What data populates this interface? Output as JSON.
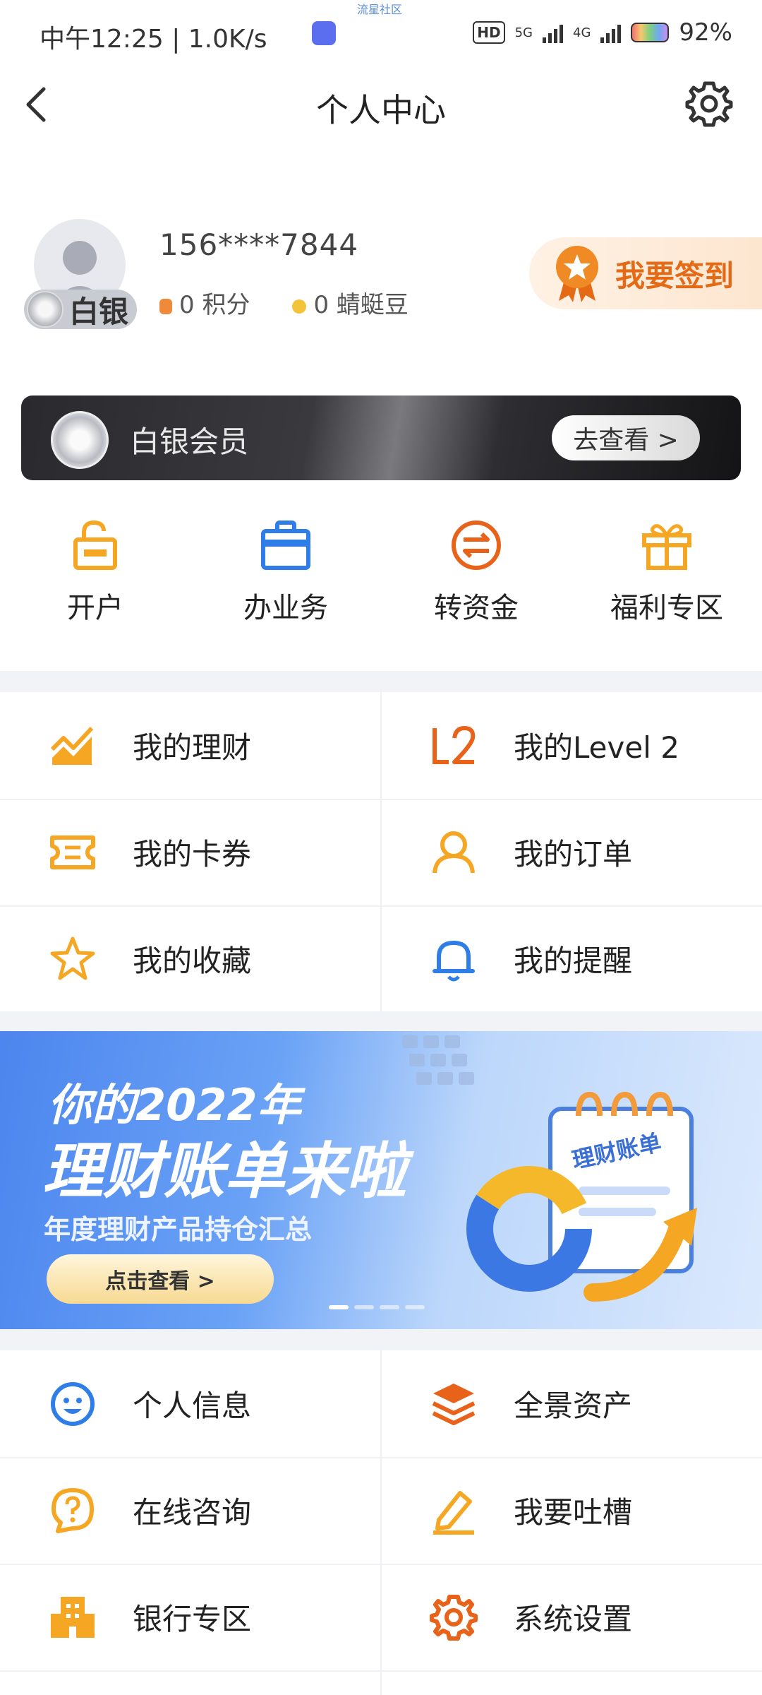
{
  "status_bar": {
    "time": "中午12:25 | 1.0K/s",
    "carrier_notice": "流星社区",
    "hd": "HD",
    "net1": "5G",
    "net2": "4G",
    "battery": "92%"
  },
  "header": {
    "title": "个人中心"
  },
  "profile": {
    "level_badge": "白银",
    "phone": "156****7844",
    "points": "0 积分",
    "beans": "0 蜻蜓豆",
    "signin_label": "我要签到"
  },
  "member": {
    "label": "白银会员",
    "button": "去查看 >"
  },
  "quick_actions": [
    {
      "label": "开户",
      "icon": "lock-open-icon"
    },
    {
      "label": "办业务",
      "icon": "briefcase-icon"
    },
    {
      "label": "转资金",
      "icon": "transfer-icon"
    },
    {
      "label": "福利专区",
      "icon": "gift-icon"
    }
  ],
  "menu1": [
    {
      "label": "我的理财",
      "icon": "chart-icon"
    },
    {
      "label": "我的Level 2",
      "icon": "level2-icon"
    },
    {
      "label": "我的卡券",
      "icon": "ticket-icon"
    },
    {
      "label": "我的订单",
      "icon": "user-icon"
    },
    {
      "label": "我的收藏",
      "icon": "star-icon"
    },
    {
      "label": "我的提醒",
      "icon": "bell-icon"
    }
  ],
  "banner": {
    "line1": "你的2022年",
    "line2": "理财账单来啦",
    "line3": "年度理财产品持仓汇总",
    "cta": "点击查看 >",
    "card_title": "理财账单"
  },
  "menu2": [
    {
      "label": "个人信息",
      "icon": "smile-icon"
    },
    {
      "label": "全景资产",
      "icon": "layers-icon"
    },
    {
      "label": "在线咨询",
      "icon": "question-bubble-icon"
    },
    {
      "label": "我要吐槽",
      "icon": "pen-icon"
    },
    {
      "label": "银行专区",
      "icon": "building-icon"
    },
    {
      "label": "系统设置",
      "icon": "settings-icon"
    }
  ],
  "colors": {
    "orange": "#f5a623",
    "deep_orange": "#e8621a",
    "blue": "#2f7ee8"
  }
}
